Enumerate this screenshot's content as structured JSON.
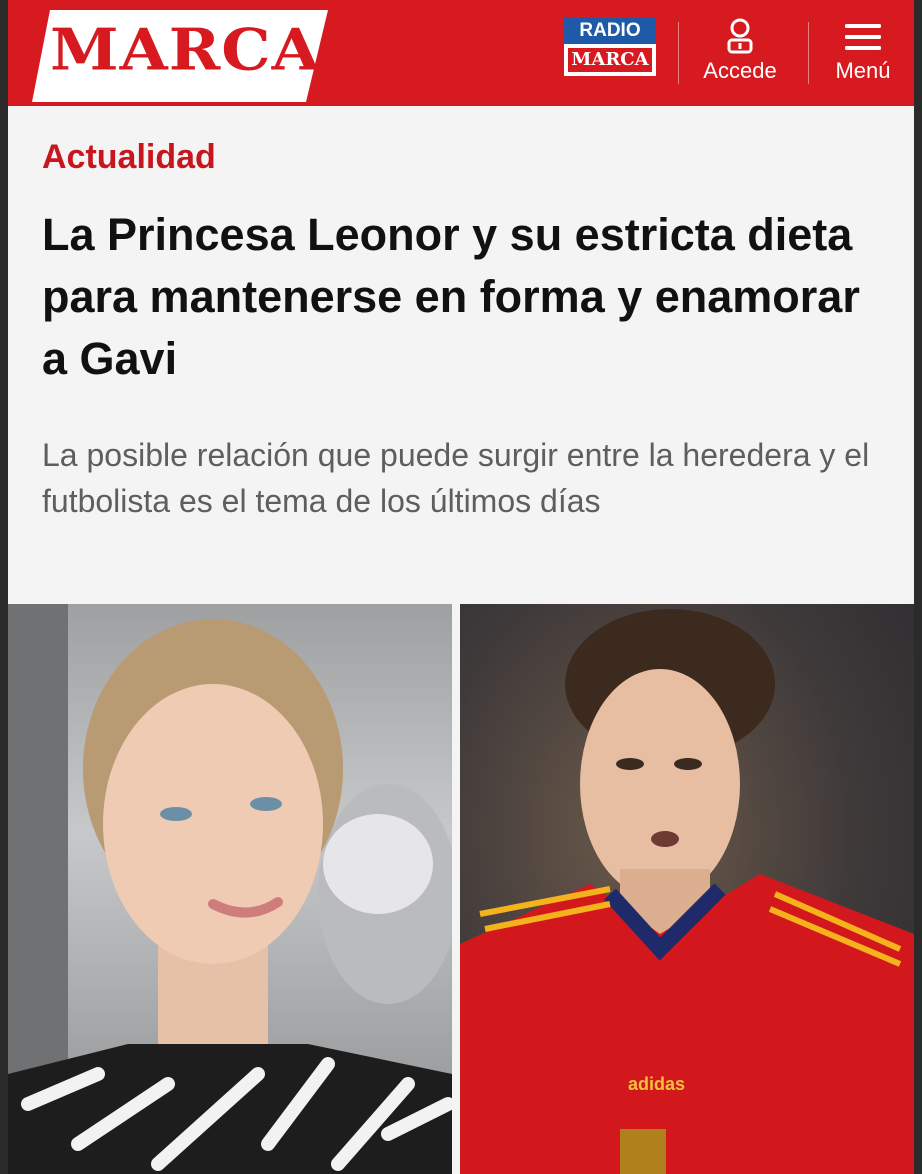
{
  "header": {
    "logo_text": "MARCA",
    "radio_top": "RADIO",
    "radio_bottom": "MARCA",
    "accede_label": "Accede",
    "menu_label": "Menú",
    "brand_color": "#d71920",
    "radio_blue": "#1e5aa8"
  },
  "article": {
    "section": "Actualidad",
    "headline": "La Princesa Leonor y su estricta dieta para mantenerse en forma y enamorar a Gavi",
    "subtitle": "La posible relación que puede surgir entre la heredera y el futbolista es el tema de los últimos días"
  },
  "photos": {
    "left_icon": "person-portrait-photo",
    "right_icon": "football-player-photo",
    "jersey_brand": "adidas"
  }
}
